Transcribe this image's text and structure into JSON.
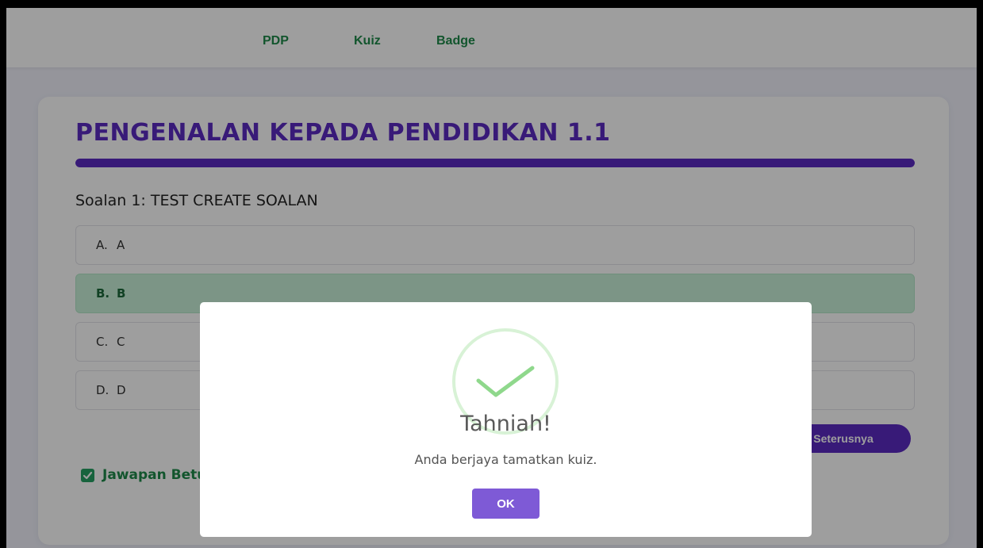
{
  "nav": {
    "items": [
      {
        "label": "PDP"
      },
      {
        "label": "Kuiz"
      },
      {
        "label": "Badge"
      }
    ]
  },
  "quiz": {
    "title": "PENGENALAN KEPADA PENDIDIKAN 1.1",
    "progress_percent": 100,
    "question": "Soalan 1: TEST CREATE SOALAN",
    "options": [
      {
        "letter": "A.",
        "text": "A",
        "selected": false
      },
      {
        "letter": "B.",
        "text": "B",
        "selected": true
      },
      {
        "letter": "C.",
        "text": "C",
        "selected": false
      },
      {
        "letter": "D.",
        "text": "D",
        "selected": false
      }
    ],
    "next_label": "Seterusnya",
    "answer_label": "Jawapan Betul"
  },
  "modal": {
    "title": "Tahniah!",
    "text": "Anda berjaya tamatkan kuiz.",
    "ok_label": "OK"
  },
  "colors": {
    "accent": "#5b2bc2",
    "success": "#26a163",
    "nav_link": "#1d8a4a"
  }
}
